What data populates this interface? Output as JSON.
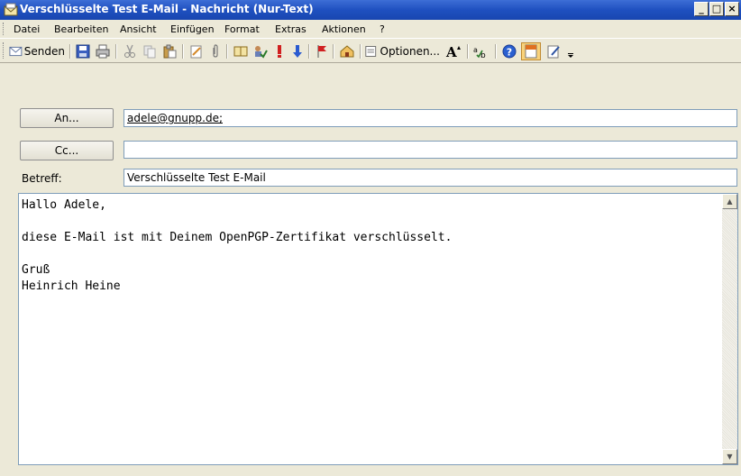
{
  "window": {
    "title": "Verschlüsselte Test E-Mail - Nachricht (Nur-Text)"
  },
  "window_buttons": {
    "minimize": "_",
    "maximize": "□",
    "close": "×"
  },
  "menu": {
    "items": [
      {
        "label": "Datei"
      },
      {
        "label": "Bearbeiten"
      },
      {
        "label": "Ansicht"
      },
      {
        "label": "Einfügen"
      },
      {
        "label": "Format"
      },
      {
        "label": "Extras"
      },
      {
        "label": "Aktionen"
      },
      {
        "label": "?"
      }
    ]
  },
  "toolbar": {
    "send_label": "Senden",
    "options_label": "Optionen...",
    "icons": [
      "save-icon",
      "print-icon",
      "cut-icon",
      "copy-icon",
      "paste-icon",
      "insert-file-icon",
      "attach-icon",
      "address-book-icon",
      "check-names-icon",
      "importance-high-icon",
      "importance-low-icon",
      "follow-up-flag-icon",
      "permission-icon",
      "options-icon",
      "font-size-icon",
      "spell-check-icon",
      "help-icon",
      "sign-icon",
      "encrypt-icon"
    ]
  },
  "header": {
    "to_button": "An...",
    "to_value": "adele@gnupp.de;",
    "cc_button": "Cc...",
    "cc_value": "",
    "subject_label": "Betreff:",
    "subject_value": "Verschlüsselte Test E-Mail"
  },
  "body": {
    "text": "Hallo Adele,\n\ndiese E-Mail ist mit Deinem OpenPGP-Zertifikat verschlüsselt.\n\nGruß\nHeinrich Heine"
  },
  "colors": {
    "titlebar": "#245edb",
    "face": "#ece9d8",
    "field_border": "#7f9db9"
  }
}
